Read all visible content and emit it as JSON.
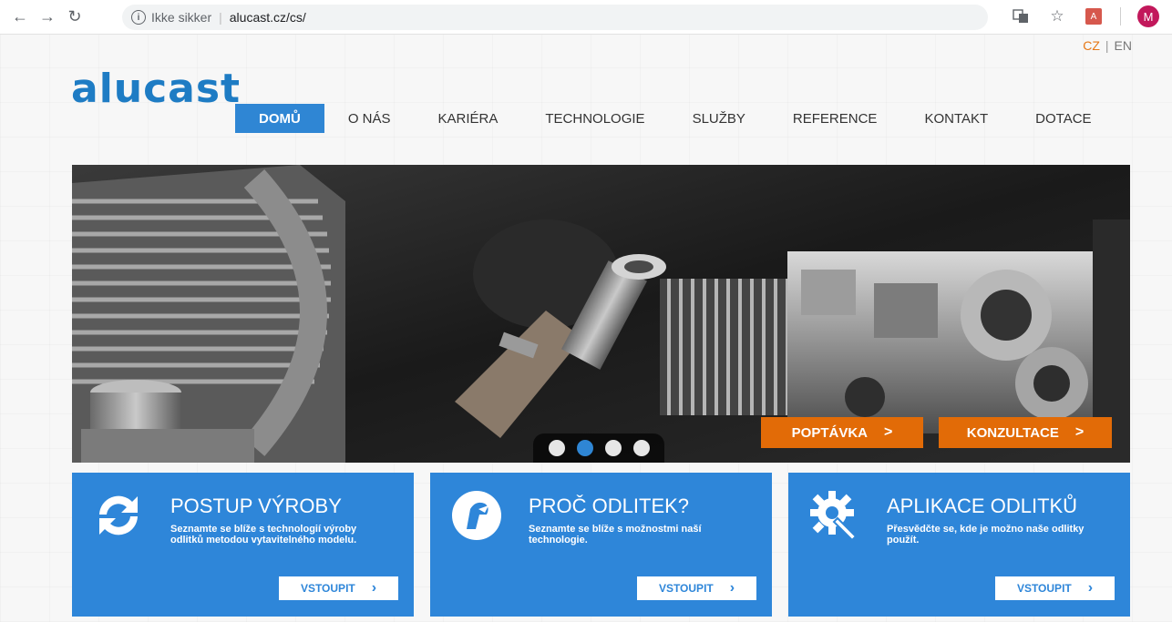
{
  "browser": {
    "security_text": "Ikke sikker",
    "url": "alucast.cz/cs/",
    "profile_initial": "M",
    "pdf_label": "A"
  },
  "lang": {
    "cz": "CZ",
    "sep": "|",
    "en": "EN"
  },
  "logo_text": "alucast",
  "menu": [
    {
      "label": "DOMŮ",
      "active": true
    },
    {
      "label": "O NÁS"
    },
    {
      "label": "KARIÉRA"
    },
    {
      "label": "TECHNOLOGIE"
    },
    {
      "label": "SLUŽBY"
    },
    {
      "label": "REFERENCE"
    },
    {
      "label": "KONTAKT"
    },
    {
      "label": "DOTACE"
    }
  ],
  "slider": {
    "active_dot": 2,
    "cta": [
      {
        "label": "POPTÁVKA",
        "chev": ">"
      },
      {
        "label": "KONZULTACE",
        "chev": ">"
      }
    ]
  },
  "cards": [
    {
      "title": "POSTUP VÝROBY",
      "text": "Seznamte se blíže s technologií výroby odlitků metodou vytavitelného modelu.",
      "button": "VSTOUPIT",
      "icon": "refresh-arrows-icon"
    },
    {
      "title": "PROČ ODLITEK?",
      "text": "Seznamte se blíže s možnostmi naší technologie.",
      "button": "VSTOUPIT",
      "icon": "casting-logo-icon"
    },
    {
      "title": "APLIKACE ODLITKŮ",
      "text": "Přesvědčte se, kde je možno naše odlitky použít.",
      "button": "VSTOUPIT",
      "icon": "gear-wrench-icon"
    }
  ],
  "colors": {
    "brand": "#1e7cc4",
    "accent_orange": "#e26b07",
    "card_blue": "#2e86d9"
  }
}
